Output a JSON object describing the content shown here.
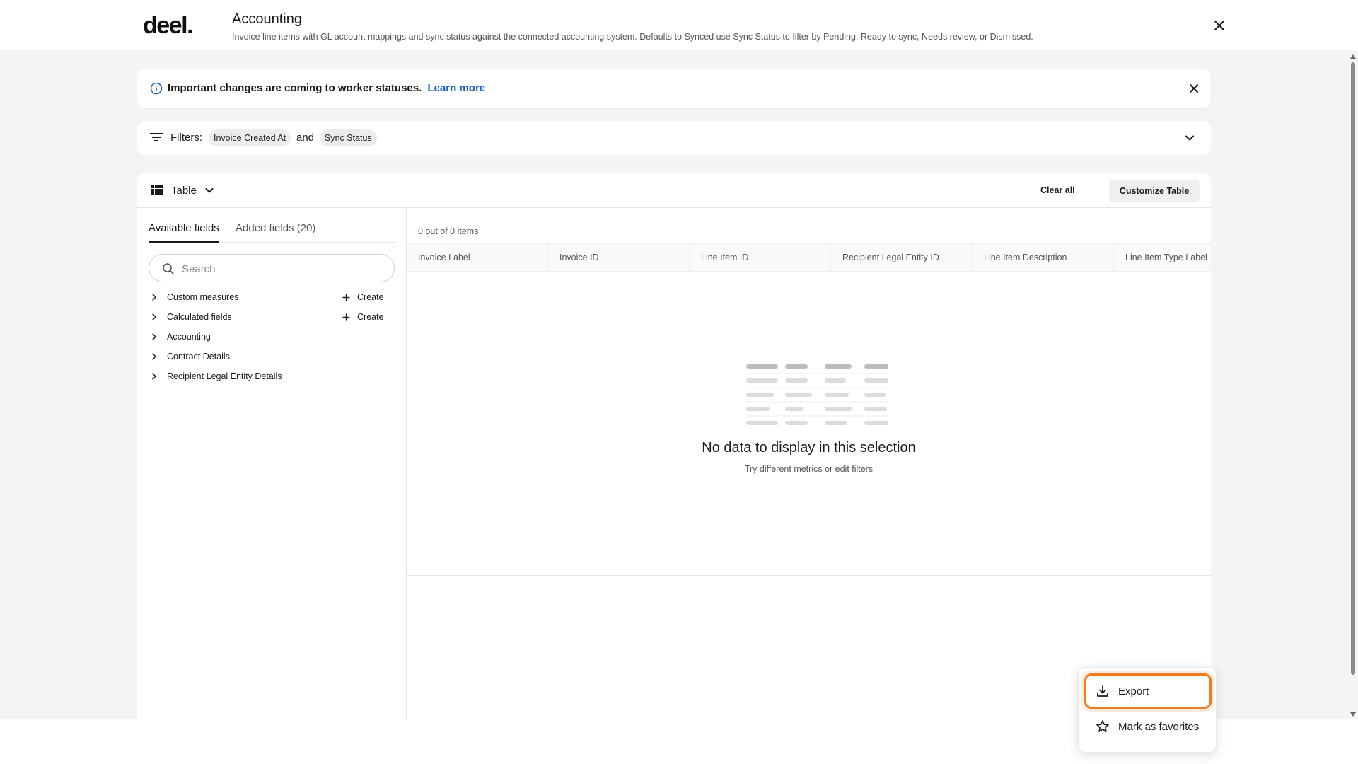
{
  "header": {
    "logo_text": "deel.",
    "title": "Accounting",
    "subtitle": "Invoice line items with GL account mappings and sync status against the connected accounting system. Defaults to Synced use Sync Status to filter by Pending, Ready to sync, Needs review, or Dismissed."
  },
  "banner": {
    "message": "Important changes are coming to worker statuses.",
    "link": "Learn more"
  },
  "filters": {
    "label": "Filters:",
    "chips": [
      "Invoice Created At",
      "Sync Status"
    ],
    "conjunction": "and"
  },
  "toolbar": {
    "view_label": "Table",
    "clear_all": "Clear all",
    "customize": "Customize Table"
  },
  "fields_panel": {
    "tabs": [
      "Available fields",
      "Added fields (20)"
    ],
    "search_placeholder": "Search",
    "create_label": "Create",
    "items": [
      {
        "label": "Custom measures",
        "creatable": true
      },
      {
        "label": "Calculated fields",
        "creatable": true
      },
      {
        "label": "Accounting",
        "creatable": false
      },
      {
        "label": "Contract Details",
        "creatable": false
      },
      {
        "label": "Recipient Legal Entity Details",
        "creatable": false
      }
    ]
  },
  "table": {
    "count": "0 out of 0 items",
    "columns": [
      "Invoice Label",
      "Invoice ID",
      "Line Item ID",
      "Recipient Legal Entity ID",
      "Line Item Description",
      "Line Item Type Label"
    ],
    "empty_title": "No data to display in this selection",
    "empty_subtitle": "Try different metrics or edit filters"
  },
  "menu": {
    "items": [
      {
        "label": "Export",
        "icon": "download-icon"
      },
      {
        "label": "Mark as favorites",
        "icon": "star-icon"
      }
    ]
  },
  "colors": {
    "accent_link": "#1d5fbf",
    "focus_ring": "#f07c1f",
    "info_icon": "#1d5fbf"
  }
}
